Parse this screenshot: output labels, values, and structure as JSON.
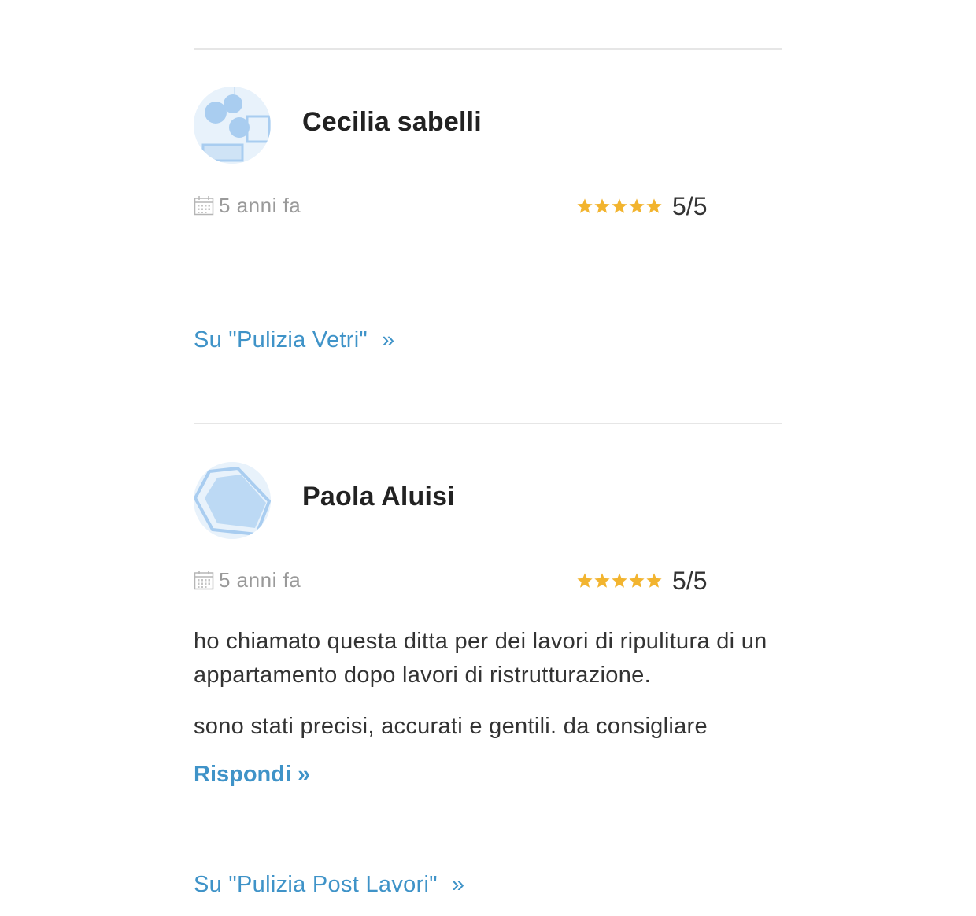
{
  "reviews": [
    {
      "author": "Cecilia sabelli",
      "date": "5 anni fa",
      "rating_value": 5,
      "rating_text": "5/5",
      "body": [],
      "reply_label": "",
      "service_link": "Su \"Pulizia Vetri\"",
      "service_arrow": "»",
      "avatar_icon": "avatar-abstract-circles-icon"
    },
    {
      "author": "Paola Aluisi",
      "date": "5 anni fa",
      "rating_value": 5,
      "rating_text": "5/5",
      "body": [
        "ho chiamato questa ditta per dei lavori di ripulitura di un appartamento dopo lavori di ristrutturazione.",
        "sono stati precisi, accurati e gentili. da consigliare"
      ],
      "reply_label": "Rispondi »",
      "service_link": "Su \"Pulizia Post Lavori\"",
      "service_arrow": "»",
      "avatar_icon": "avatar-abstract-hexagon-icon"
    }
  ],
  "colors": {
    "link": "#3f93c8",
    "star": "#f2b42f",
    "divider": "#e6e6e6",
    "muted": "#9a9a9a"
  }
}
